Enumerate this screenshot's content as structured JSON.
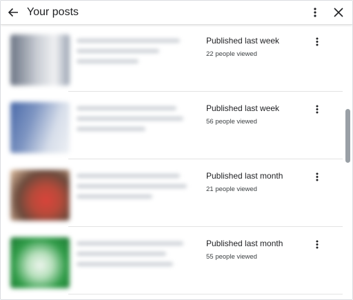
{
  "header": {
    "title": "Your posts",
    "back_icon": "arrow-left-icon",
    "more_icon": "more-vert-icon",
    "close_icon": "close-icon"
  },
  "posts": [
    {
      "status": "Published last week",
      "views": "22 people viewed",
      "thumb_colors": [
        "#5f6b7d",
        "#c8ccd4",
        "#eef0f3"
      ]
    },
    {
      "status": "Published last week",
      "views": "56 people viewed",
      "thumb_colors": [
        "#4f6fae",
        "#aebbd6",
        "#e8ecf2"
      ]
    },
    {
      "status": "Published last month",
      "views": "21 people viewed",
      "thumb_colors": [
        "#c4503e",
        "#7a4034",
        "#e7c7a9"
      ]
    },
    {
      "status": "Published last month",
      "views": "55 people viewed",
      "thumb_colors": [
        "#2e9a45",
        "#8fd19a",
        "#f2f7f2"
      ]
    }
  ]
}
